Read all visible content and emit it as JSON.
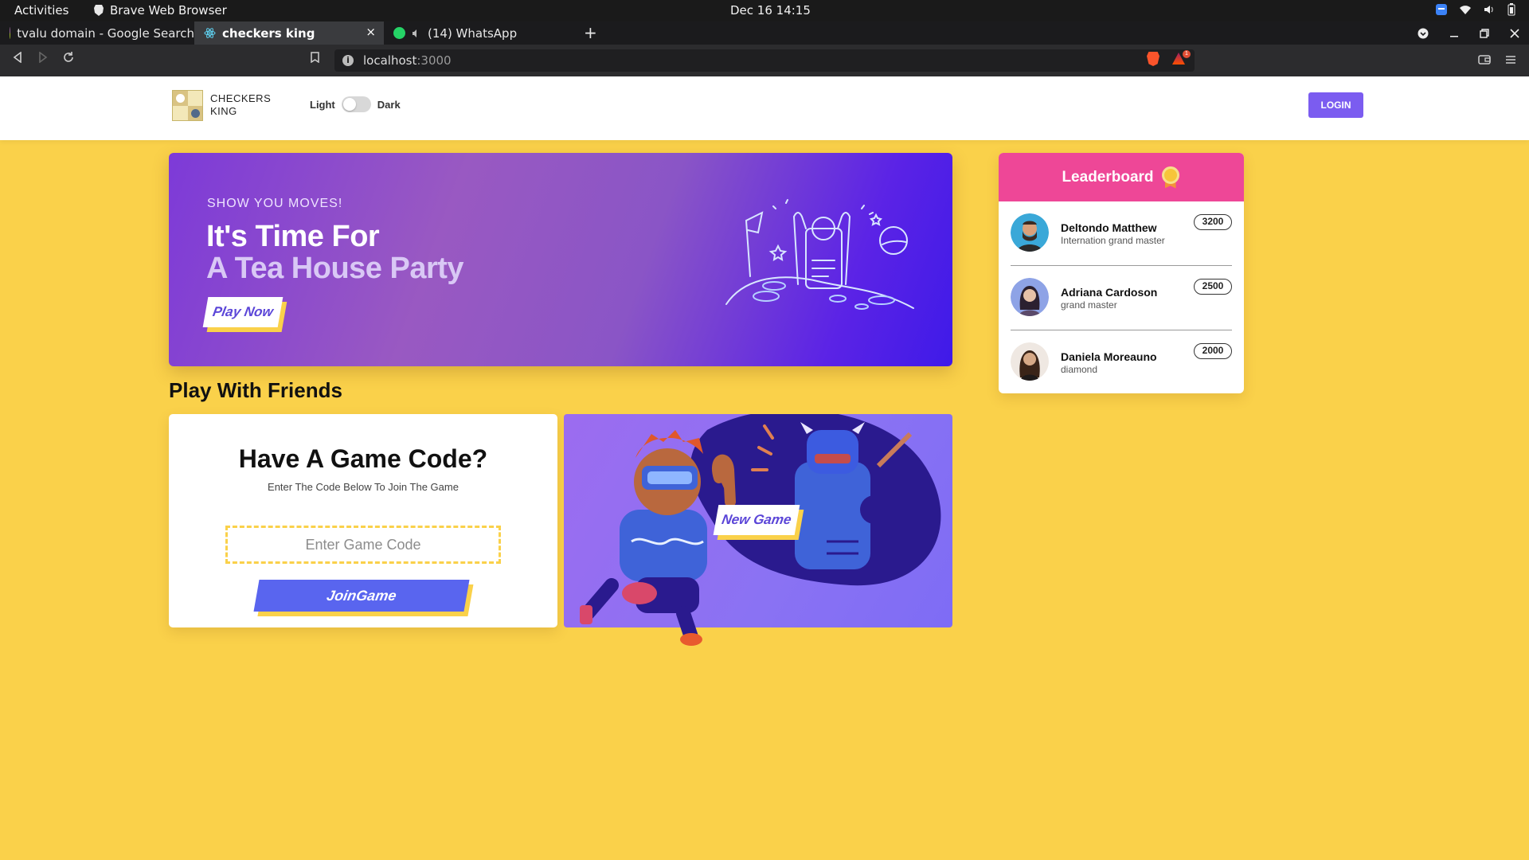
{
  "system_bar": {
    "activities": "Activities",
    "app_name": "Brave Web Browser",
    "clock": "Dec 16  14:15"
  },
  "browser": {
    "tabs": [
      {
        "label": "tvalu domain - Google Search",
        "favicon": "google-icon"
      },
      {
        "label": "checkers king",
        "favicon": "react-icon",
        "active": true
      },
      {
        "label": "(14) WhatsApp",
        "favicon": "whatsapp-icon",
        "muted": true
      }
    ],
    "close_tab_glyph": "×",
    "new_tab_glyph": "+",
    "url": {
      "host": "localhost",
      "port": ":3000"
    },
    "shields_badge": "1"
  },
  "header": {
    "logo_line1": "CHECKERS",
    "logo_line2": "KING",
    "theme_light": "Light",
    "theme_dark": "Dark",
    "login": "LOGIN",
    "accent": "#7b5cf0"
  },
  "hero": {
    "eyebrow": "SHOW YOU MOVES!",
    "title_line1": "It's Time For",
    "title_line2": "A Tea House Party",
    "cta": "Play Now"
  },
  "friends": {
    "section_title": "Play With Friends",
    "code_card": {
      "title": "Have A Game Code?",
      "subtitle": "Enter The Code Below To Join The Game",
      "placeholder": "Enter Game Code",
      "join_label": "JoinGame"
    },
    "new_game_label": "New Game"
  },
  "leaderboard": {
    "title": "Leaderboard",
    "players": [
      {
        "name": "Deltondo Matthew",
        "rank": "Internation grand master",
        "score": "3200"
      },
      {
        "name": "Adriana Cardoson",
        "rank": "grand master",
        "score": "2500"
      },
      {
        "name": "Daniela Moreauno",
        "rank": "diamond",
        "score": "2000"
      }
    ]
  },
  "colors": {
    "page_bg": "#FAD14A",
    "leaderboard_header": "#ee4797",
    "join_button": "#5965ef"
  }
}
